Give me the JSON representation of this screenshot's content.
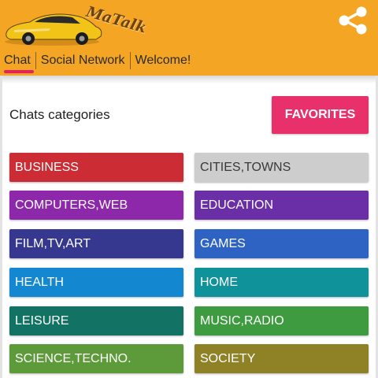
{
  "header": {
    "app_name": "MaTalk",
    "background_color": "#f5a524",
    "logo_icon": "sports-car-icon",
    "share_icon": "share-icon"
  },
  "tabs": [
    {
      "label": "Chat",
      "active": true
    },
    {
      "label": "Social Network",
      "active": false
    },
    {
      "label": "Welcome!",
      "active": false
    }
  ],
  "main": {
    "section_label": "Chats categories",
    "favorites_label": "FAVORITES",
    "favorites_color": "#e8316a"
  },
  "categories": [
    {
      "label": "BUSINESS",
      "color": "#cc2c33"
    },
    {
      "label": "CITIES,TOWNS",
      "color": "#cdcdcd"
    },
    {
      "label": "COMPUTERS,WEB",
      "color": "#8c28a9"
    },
    {
      "label": "EDUCATION",
      "color": "#6a2ea6"
    },
    {
      "label": "FILM,TV,ART",
      "color": "#36378e"
    },
    {
      "label": "GAMES",
      "color": "#2e63c4"
    },
    {
      "label": "HEALTH",
      "color": "#1387cf"
    },
    {
      "label": "HOME",
      "color": "#10929a"
    },
    {
      "label": "LEISURE",
      "color": "#127365"
    },
    {
      "label": "MUSIC,RADIO",
      "color": "#3e9b3f"
    },
    {
      "label": "SCIENCE,TECHNO.",
      "color": "#5d9b3a"
    },
    {
      "label": "SOCIETY",
      "color": "#8e8126"
    }
  ]
}
